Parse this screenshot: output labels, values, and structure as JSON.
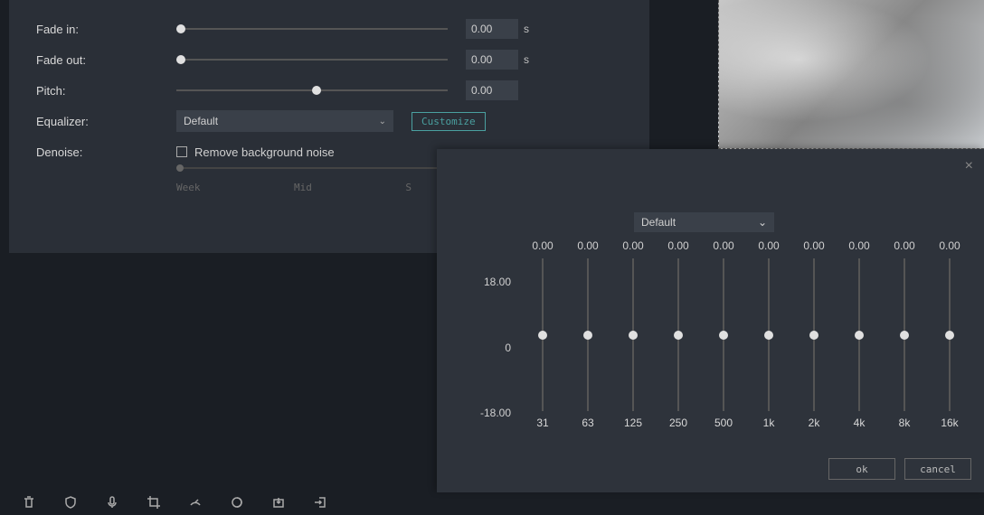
{
  "audio": {
    "fade_in": {
      "label": "Fade in:",
      "value": "0.00",
      "unit": "s"
    },
    "fade_out": {
      "label": "Fade out:",
      "value": "0.00",
      "unit": "s"
    },
    "pitch": {
      "label": "Pitch:",
      "value": "0.00"
    },
    "equalizer": {
      "label": "Equalizer:",
      "value": "Default",
      "customize": "Customize"
    },
    "denoise": {
      "label": "Denoise:",
      "checkbox_label": "Remove background noise",
      "scale": {
        "weak": "Week",
        "mid": "Mid",
        "strong": "S"
      }
    }
  },
  "eq_dialog": {
    "preset": "Default",
    "scale": {
      "max": "18.00",
      "mid": "0",
      "min": "-18.00"
    },
    "bands": [
      {
        "value": "0.00",
        "freq": "31"
      },
      {
        "value": "0.00",
        "freq": "63"
      },
      {
        "value": "0.00",
        "freq": "125"
      },
      {
        "value": "0.00",
        "freq": "250"
      },
      {
        "value": "0.00",
        "freq": "500"
      },
      {
        "value": "0.00",
        "freq": "1k"
      },
      {
        "value": "0.00",
        "freq": "2k"
      },
      {
        "value": "0.00",
        "freq": "4k"
      },
      {
        "value": "0.00",
        "freq": "8k"
      },
      {
        "value": "0.00",
        "freq": "16k"
      }
    ],
    "buttons": {
      "ok": "ok",
      "cancel": "cancel"
    }
  },
  "toolbar_icons": [
    "delete",
    "shield",
    "mic",
    "crop",
    "speed",
    "color",
    "export",
    "login"
  ]
}
